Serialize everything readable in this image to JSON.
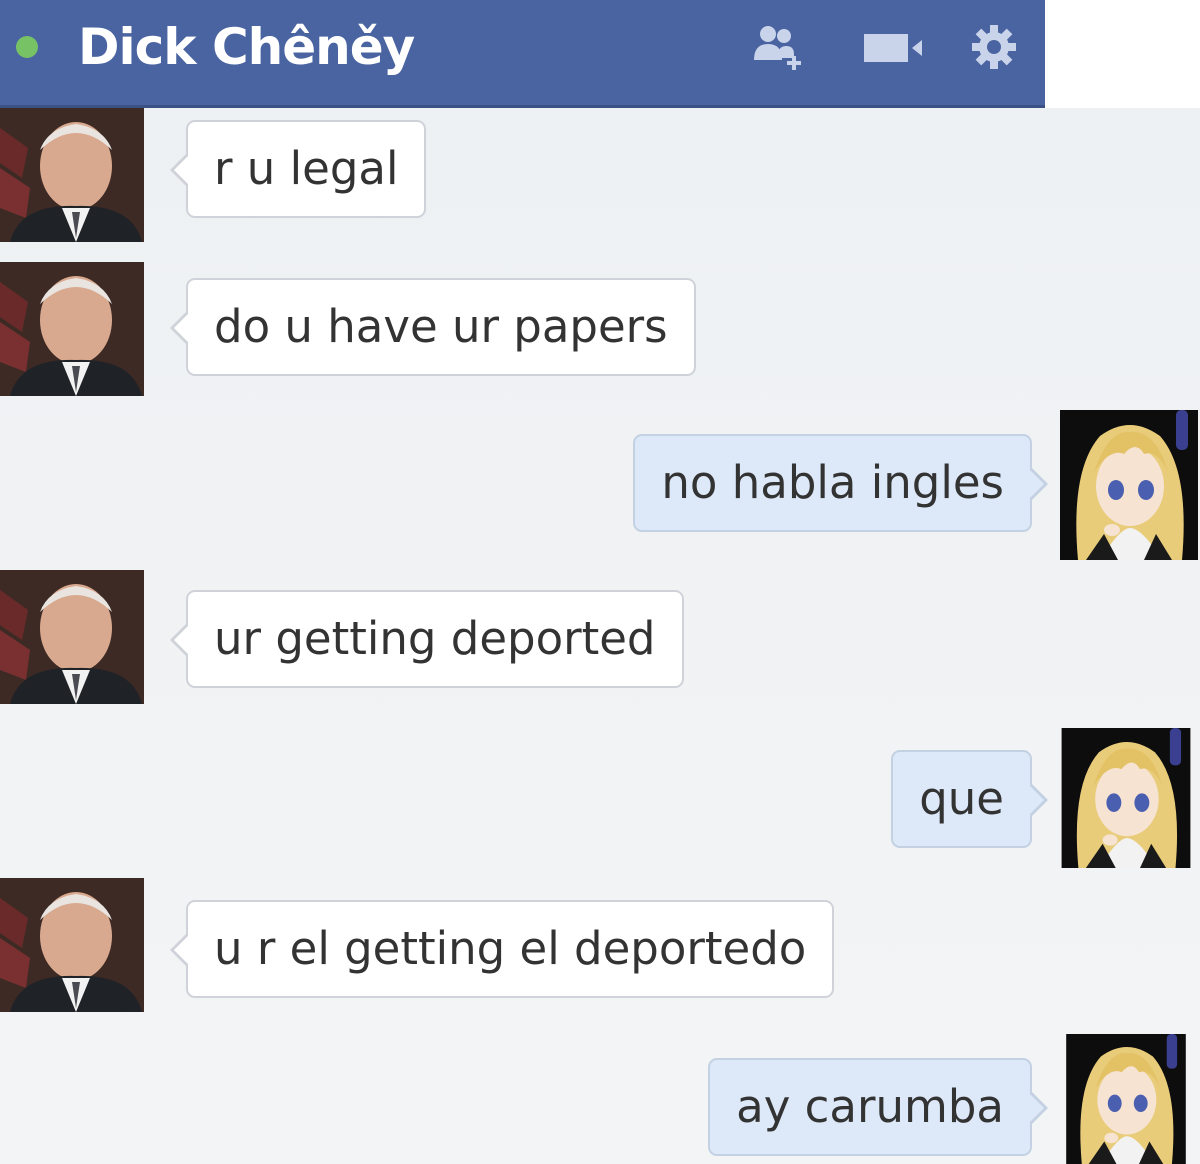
{
  "header": {
    "title": "Dick Chêněy",
    "status": "online",
    "status_color": "#78c266",
    "bar_color": "#4a64a1",
    "icons": [
      "add-friend-icon",
      "video-call-icon",
      "gear-icon"
    ]
  },
  "messages": [
    {
      "sender": "contact",
      "text": "r u legal"
    },
    {
      "sender": "contact",
      "text": "do u have ur papers"
    },
    {
      "sender": "self",
      "text": "no habla ingles"
    },
    {
      "sender": "contact",
      "text": "ur getting deported"
    },
    {
      "sender": "self",
      "text": "que"
    },
    {
      "sender": "contact",
      "text": "u r el getting el deportedo"
    },
    {
      "sender": "self",
      "text": "ay carumba"
    }
  ]
}
